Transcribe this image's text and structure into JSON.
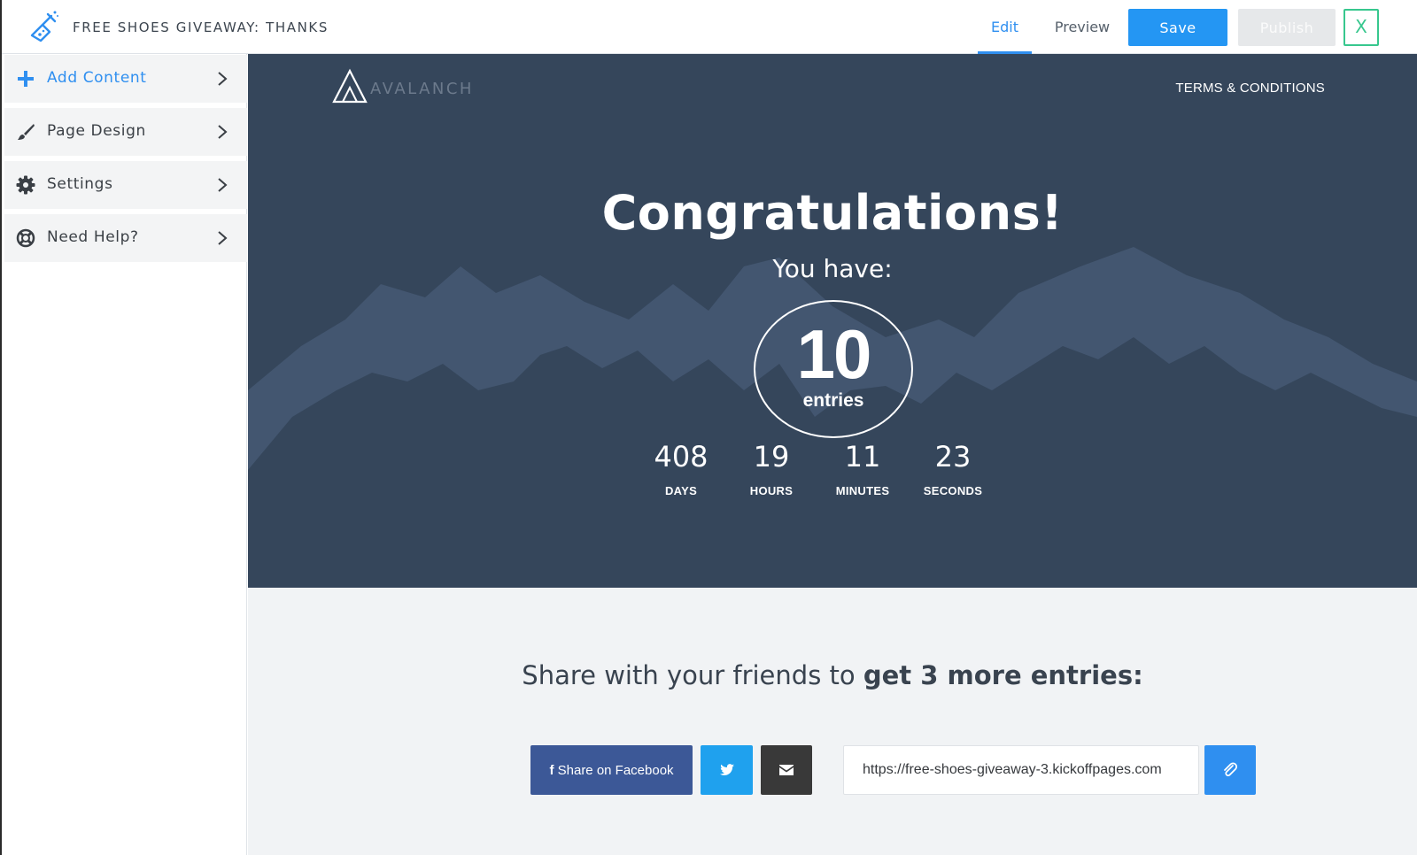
{
  "topbar": {
    "page_name": "FREE SHOES GIVEAWAY: THANKS",
    "tabs": [
      {
        "label": "Edit",
        "active": true
      },
      {
        "label": "Preview",
        "active": false
      }
    ],
    "save_label": "Save",
    "publish_label": "Publish",
    "close_label": "X"
  },
  "sidebar": {
    "items": [
      {
        "label": "Add Content",
        "icon": "plus-icon",
        "active": true
      },
      {
        "label": "Page Design",
        "icon": "brush-icon",
        "active": false
      },
      {
        "label": "Settings",
        "icon": "gear-icon",
        "active": false
      },
      {
        "label": "Need Help?",
        "icon": "lifebuoy-icon",
        "active": false
      }
    ]
  },
  "hero": {
    "brand": "AVALANCH",
    "terms_link": "TERMS & CONDITIONS",
    "title": "Congratulations!",
    "subtitle": "You have:",
    "entries_count": "10",
    "entries_label": "entries",
    "countdown": [
      {
        "value": "408",
        "label": "DAYS"
      },
      {
        "value": "19",
        "label": "HOURS"
      },
      {
        "value": "11",
        "label": "MINUTES"
      },
      {
        "value": "23",
        "label": "SECONDS"
      }
    ]
  },
  "share": {
    "title_plain": "Share with your friends to ",
    "title_bold": "get 3 more entries:",
    "facebook_label": "Share on Facebook",
    "share_url": "https://free-shoes-giveaway-3.kickoffpages.com"
  },
  "colors": {
    "accent": "#2496f3",
    "hero_bg": "#35465b",
    "close_green": "#37c78e",
    "facebook": "#3c5897",
    "twitter": "#1fa1ee"
  }
}
